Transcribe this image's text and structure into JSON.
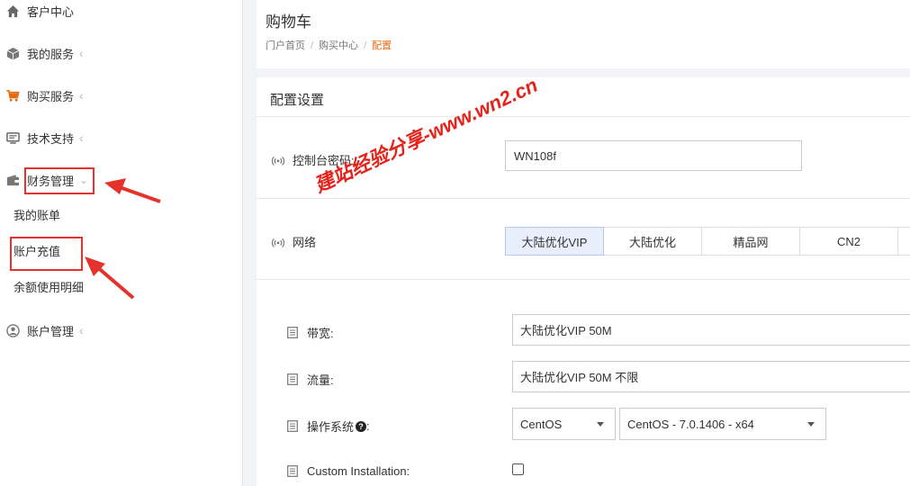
{
  "sidebar": {
    "items": [
      {
        "label": "客户中心",
        "icon": "home-icon"
      },
      {
        "label": "我的服务",
        "icon": "box-icon"
      },
      {
        "label": "购买服务",
        "icon": "cart-icon"
      },
      {
        "label": "技术支持",
        "icon": "monitor-icon"
      },
      {
        "label": "财务管理",
        "icon": "wallet-icon"
      },
      {
        "label": "账户管理",
        "icon": "user-circle-icon"
      }
    ],
    "finance_sub": [
      "我的账单",
      "账户充值",
      "余额使用明细"
    ]
  },
  "header": {
    "title": "购物车",
    "breadcrumb": [
      "门户首页",
      "购买中心",
      "配置"
    ],
    "breadcrumb_sep": "/"
  },
  "config": {
    "title": "配置设置",
    "password_label": "控制台密码:",
    "password_value": "WN108f",
    "network_label": "网络",
    "network_options": [
      "大陆优化VIP",
      "大陆优化",
      "精品网",
      "CN2"
    ],
    "bandwidth_label": "带宽:",
    "bandwidth_value": "大陆优化VIP 50M",
    "traffic_label": "流量:",
    "traffic_value": "大陆优化VIP 50M 不限",
    "os_label": "操作系统",
    "os_help": "?",
    "os_colon": ":",
    "os_family": "CentOS",
    "os_version": "CentOS - 7.0.1406 - x64",
    "custom_label": "Custom Installation:"
  },
  "watermark": "建站经验分享-www.wn2.cn",
  "colors": {
    "accent": "#e86a10",
    "annotation_red": "#e5322d",
    "active_option_bg": "#e8eefc"
  }
}
